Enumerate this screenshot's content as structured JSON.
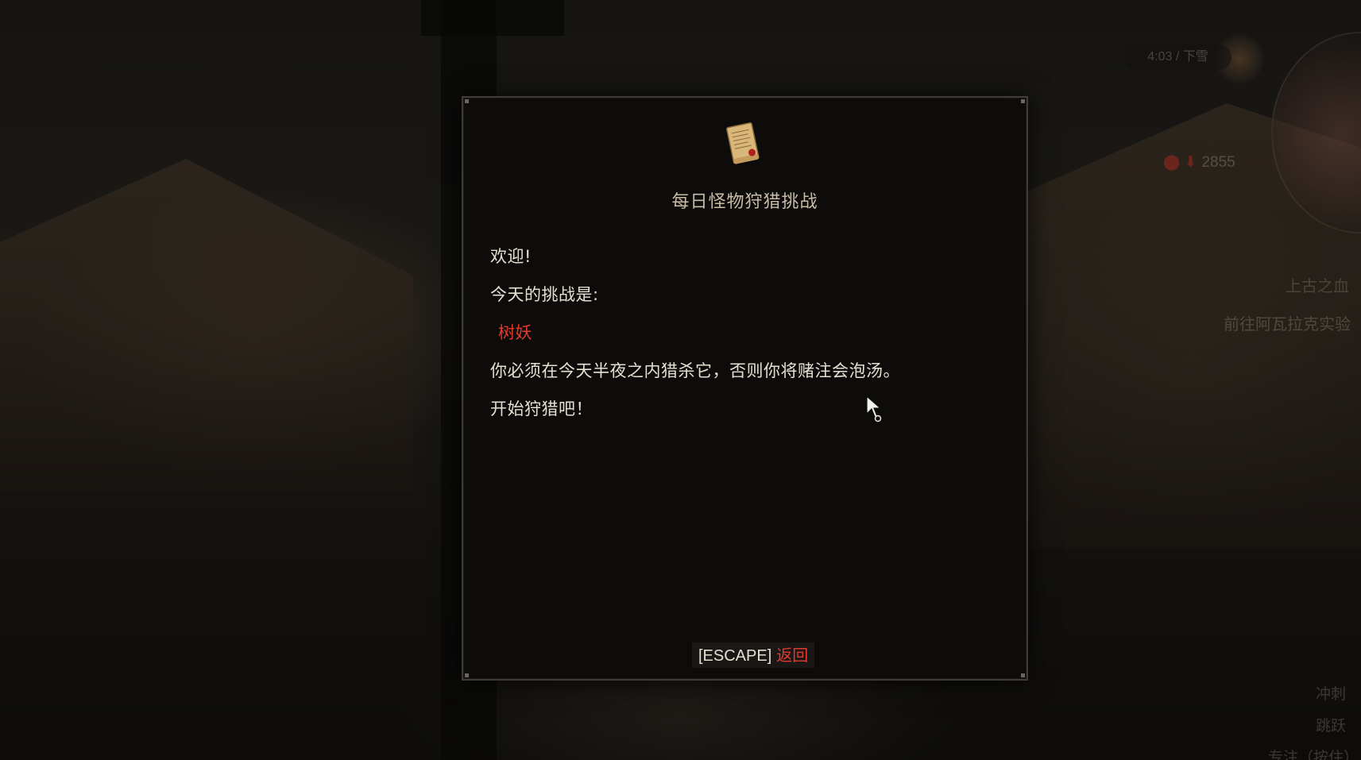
{
  "dialog": {
    "icon": "scroll-letter-icon",
    "title": "每日怪物狩猎挑战",
    "greeting": "欢迎!",
    "challenge_intro": "今天的挑战是:",
    "target_monster": "树妖",
    "instruction": "你必须在今天半夜之内猎杀它，否则你将赌注会泡汤。",
    "closing": "开始狩猎吧！",
    "footer": {
      "key": "[ESCAPE]",
      "action": "返回"
    }
  },
  "hud": {
    "clock": "4:03 / 下雪",
    "currency": "2855",
    "quest_title": "上古之血",
    "quest_objective": "前往阿瓦拉克实验",
    "controls": [
      "冲刺",
      "跳跃",
      "专注（按住）"
    ]
  },
  "colors": {
    "accent_red": "#e23a2e",
    "panel_bg": "#0d0c0b",
    "panel_border": "#3f3c37",
    "title_text": "#c8bca8",
    "body_text": "#e6dfd2"
  }
}
